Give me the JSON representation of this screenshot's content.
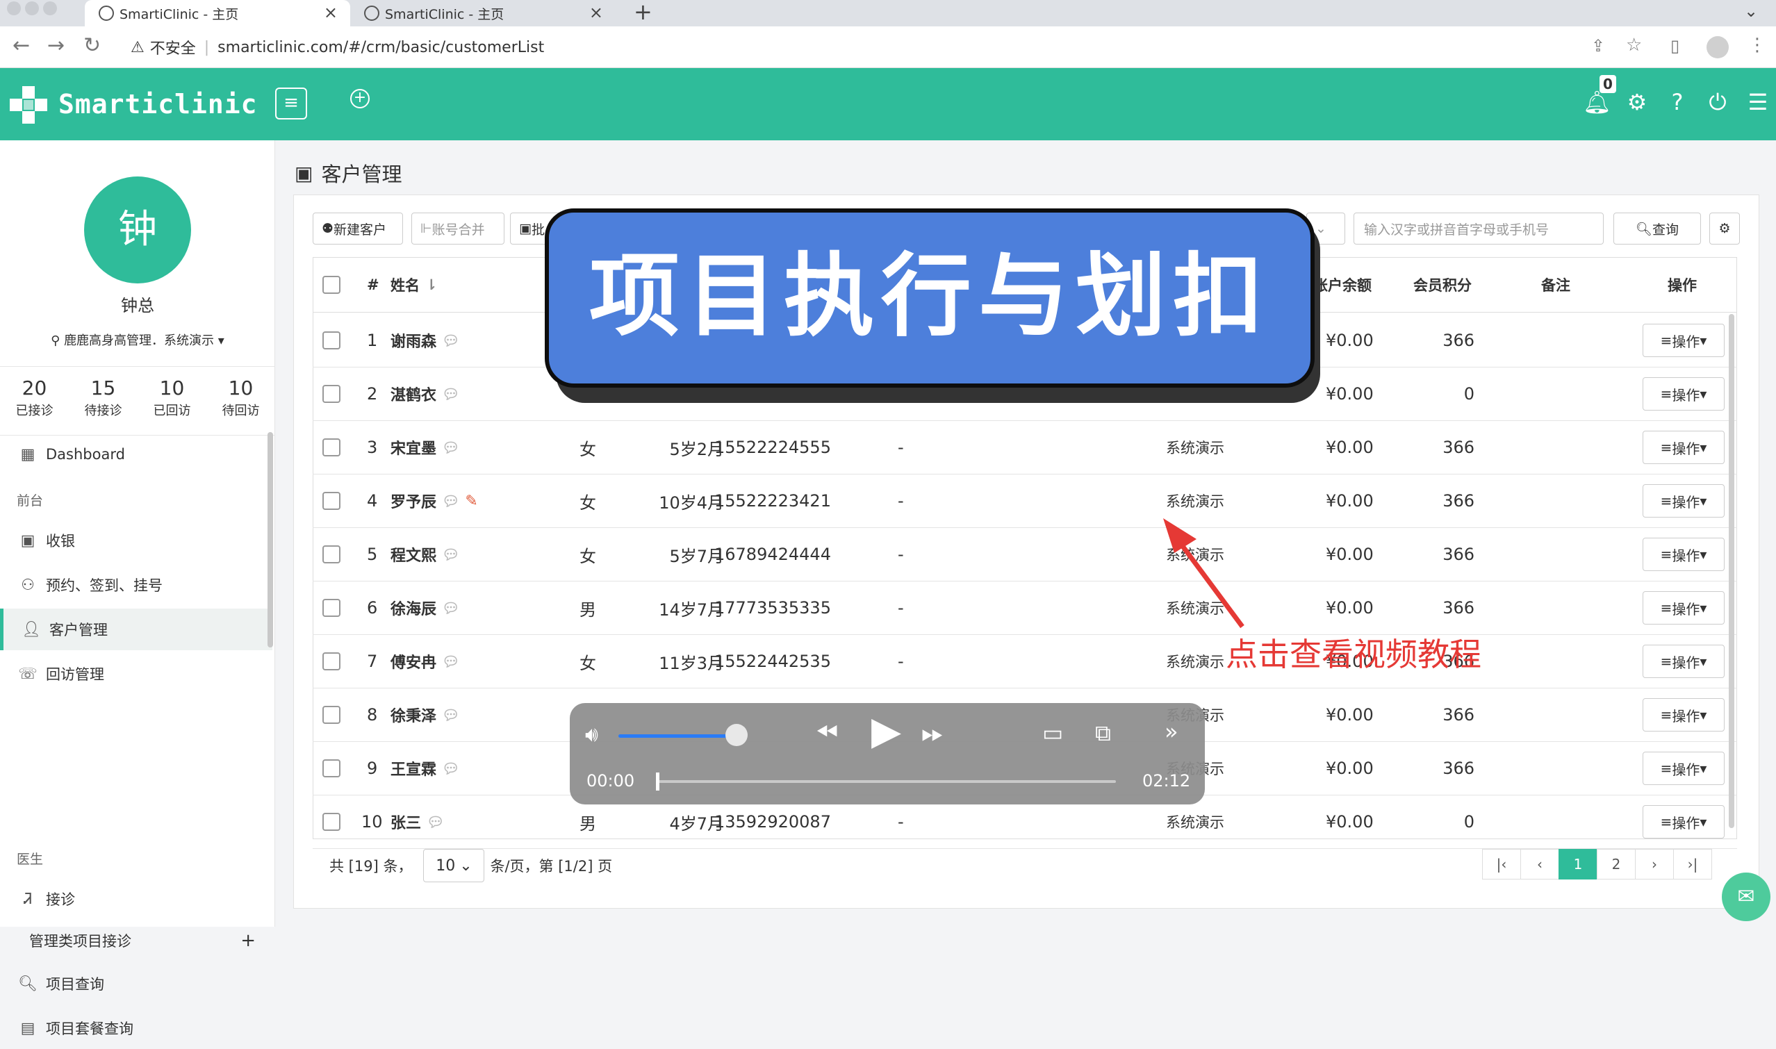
{
  "browser": {
    "tabs": [
      {
        "title": "SmartiClinic - 主页"
      },
      {
        "title": "SmartiClinic - 主页"
      }
    ],
    "new_tab": "+",
    "security_label": "不安全",
    "url": "smarticlinic.com/#/crm/basic/customerList"
  },
  "header": {
    "brand": "Smarticlinic",
    "notification_count": "0"
  },
  "sidebar": {
    "avatar_char": "钟",
    "user_name": "钟总",
    "location": "鹿鹿高身高管理．系统演示",
    "stats": [
      {
        "value": "20",
        "label": "已接诊"
      },
      {
        "value": "15",
        "label": "待接诊"
      },
      {
        "value": "10",
        "label": "已回访"
      },
      {
        "value": "10",
        "label": "待回访"
      }
    ],
    "dashboard": "Dashboard",
    "section_front": "前台",
    "item_cashier": "收银",
    "item_booking": "预约、签到、挂号",
    "item_customer": "客户管理",
    "item_followup": "回访管理",
    "section_doctor": "医生",
    "item_reception": "接诊",
    "item_mgmt_reception": "管理类项目接诊",
    "item_mgmt_plus": "+",
    "item_project_query": "项目查询",
    "item_package_query": "项目套餐查询"
  },
  "page": {
    "title": "客户管理",
    "toolbar": {
      "new_customer": "新建客户",
      "merge_accounts": "账号合并",
      "batch_partial": "批"
    },
    "search_placeholder": "输入汉字或拼音首字母或手机号",
    "query_button": "查询"
  },
  "table": {
    "headers": {
      "index": "#",
      "name": "姓名",
      "balance": "账户余额",
      "points": "会员积分",
      "remark": "备注",
      "action": "操作"
    },
    "action_label": "操作",
    "rows": [
      {
        "idx": "1",
        "name": "谢雨森",
        "gender": "",
        "age": "",
        "phone": "",
        "dash": "",
        "source": "",
        "balance": "¥0.00",
        "points": "366"
      },
      {
        "idx": "2",
        "name": "湛鹤衣",
        "gender": "",
        "age": "",
        "phone": "",
        "dash": "",
        "source": "",
        "balance": "¥0.00",
        "points": "0"
      },
      {
        "idx": "3",
        "name": "宋宜墨",
        "gender": "女",
        "age": "5岁2月",
        "phone": "15522224555",
        "dash": "-",
        "source": "系统演示",
        "balance": "¥0.00",
        "points": "366"
      },
      {
        "idx": "4",
        "name": "罗予辰",
        "gender": "女",
        "age": "10岁4月",
        "phone": "15522223421",
        "dash": "-",
        "source": "系统演示",
        "balance": "¥0.00",
        "points": "366"
      },
      {
        "idx": "5",
        "name": "程文熙",
        "gender": "女",
        "age": "5岁7月",
        "phone": "16789424444",
        "dash": "-",
        "source": "系统演示",
        "balance": "¥0.00",
        "points": "366"
      },
      {
        "idx": "6",
        "name": "徐海辰",
        "gender": "男",
        "age": "14岁7月",
        "phone": "17773535335",
        "dash": "-",
        "source": "系统演示",
        "balance": "¥0.00",
        "points": "366"
      },
      {
        "idx": "7",
        "name": "傅安冉",
        "gender": "女",
        "age": "11岁3月",
        "phone": "15522442535",
        "dash": "-",
        "source": "系统演示",
        "balance": "¥0.00",
        "points": "366"
      },
      {
        "idx": "8",
        "name": "徐秉泽",
        "gender": "",
        "age": "",
        "phone": "",
        "dash": "",
        "source": "系统演示",
        "balance": "¥0.00",
        "points": "366"
      },
      {
        "idx": "9",
        "name": "王宣霖",
        "gender": "",
        "age": "",
        "phone": "",
        "dash": "",
        "source": "系统演示",
        "balance": "¥0.00",
        "points": "366"
      },
      {
        "idx": "10",
        "name": "张三",
        "gender": "男",
        "age": "4岁7月",
        "phone": "13592920087",
        "dash": "-",
        "source": "系统演示",
        "balance": "¥0.00",
        "points": "0"
      }
    ]
  },
  "pagination": {
    "total_text": "共 [19] 条，",
    "page_size": "10",
    "per_page_text": "条/页，第 [1/2] 页",
    "first": "|‹",
    "prev": "‹",
    "pages": [
      "1",
      "2"
    ],
    "current_page": "1",
    "next": "›",
    "last": "›|"
  },
  "overlay": {
    "banner": "项目执行与划扣",
    "tutorial_hint": "点击查看视频教程"
  },
  "player": {
    "current_time": "00:00",
    "duration": "02:12",
    "progress": 0,
    "volume": 0.85
  },
  "colors": {
    "brand": "#2fbc9a",
    "banner": "#4d7fdb",
    "hint": "#e53935"
  }
}
